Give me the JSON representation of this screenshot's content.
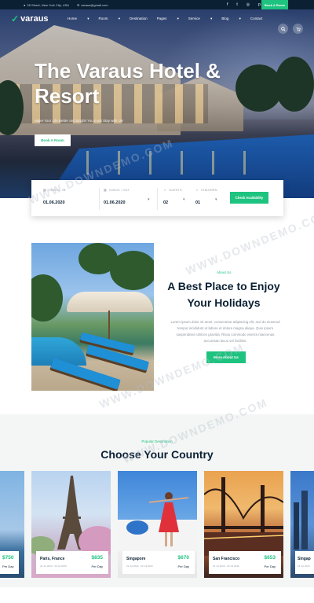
{
  "topbar": {
    "address": "28 Street, New York City, USA",
    "email": "varaus@gmail.com",
    "social_icons": [
      "facebook-icon",
      "twitter-icon",
      "instagram-icon",
      "pinterest-icon"
    ],
    "book_button": "Book A Room"
  },
  "header": {
    "logo_text": "Varaus",
    "menu": [
      {
        "label": "Home"
      },
      {
        "label": "Room"
      },
      {
        "label": "Destination"
      },
      {
        "label": "Pages"
      },
      {
        "label": "Service"
      },
      {
        "label": "Blog"
      },
      {
        "label": "Contact"
      }
    ]
  },
  "hero": {
    "title": "The Varaus Hotel & Resort",
    "subtitle": "Make Your Life Better and Bright! You must Stay with Us!",
    "button": "Book A Room"
  },
  "booking": {
    "checkin_label": "CHECK - IN",
    "checkin_value": "01.06.2020",
    "checkout_label": "CHECK - OUT",
    "checkout_value": "01.06.2020",
    "guests_label": "GUESTS",
    "guests_value": "02",
    "children_label": "CHILDREN",
    "children_value": "01",
    "button": "Check Availability"
  },
  "about": {
    "tag": "About Us",
    "title": "A Best Place to Enjoy Your Holidays",
    "description": "Lorem ipsum dolor sit amet, consectetur adipiscing elit, sed do eiusmod tempor incididunt ut labore et dolore magna aliqua. Quis ipsum suspendisse ultrices gravida. Risus commodo viverra maecenas accumsan lacus vel facilisis.",
    "button": "More About Us"
  },
  "countries": {
    "tag": "Popular Destination",
    "title": "Choose Your Country",
    "cards": [
      {
        "name": "",
        "date": "",
        "price": "$750",
        "per": "Per Day"
      },
      {
        "name": "Paris, France",
        "date": "22 Jul 2020 - 30 Jul 2020",
        "price": "$835",
        "per": "Per Day"
      },
      {
        "name": "Singapore",
        "date": "22 Jul 2020 - 30 Jul 2020",
        "price": "$670",
        "per": "Per Day"
      },
      {
        "name": "San Francisco",
        "date": "22 Jul 2020 - 30 Jul 2020",
        "price": "$653",
        "per": "Per Day"
      },
      {
        "name": "Singap",
        "date": "22 Jul 2020",
        "price": "",
        "per": ""
      }
    ]
  },
  "watermark": "WWW.DOWNDEMO.COM"
}
